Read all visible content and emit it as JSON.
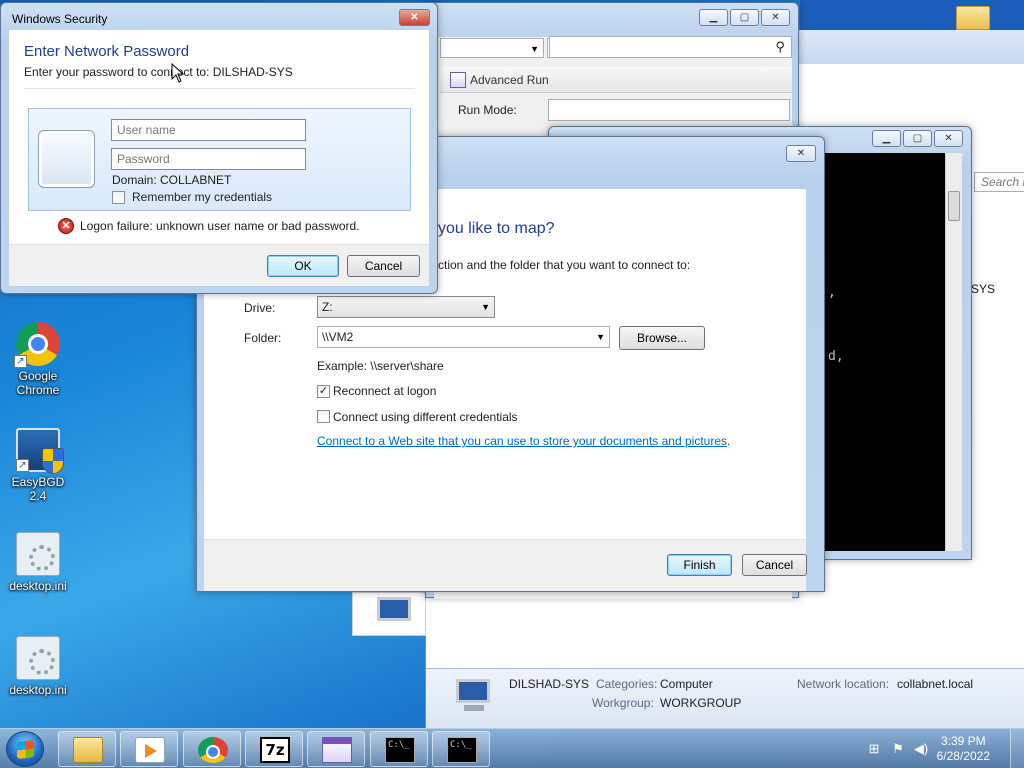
{
  "desktop": {
    "icons": [
      {
        "label": "Google Chrome"
      },
      {
        "label": "EasyBGD 2.4"
      },
      {
        "label": "desktop.ini"
      },
      {
        "label": "desktop.ini"
      }
    ]
  },
  "explorer": {
    "search_placeholder": "Search N",
    "partial_label": "SYS",
    "details": {
      "computer_name": "DILSHAD-SYS",
      "categories_label": "Categories:",
      "categories_value": "Computer",
      "workgroup_label": "Workgroup:",
      "workgroup_value": "WORKGROUP",
      "network_label": "Network location:",
      "network_value": "collabnet.local"
    }
  },
  "advanced_run": {
    "title": "Advanced Run",
    "run_mode_label": "Run Mode:"
  },
  "console": {
    "line1": ",",
    "line2": "d,"
  },
  "map_drive": {
    "heading": "you like to map?",
    "instruction": "ction and the folder that you want to connect to:",
    "drive_label": "Drive:",
    "drive_value": "Z:",
    "folder_label": "Folder:",
    "folder_value": "\\\\VM2",
    "browse_label": "Browse...",
    "example_text": "Example: \\\\server\\share",
    "reconnect_label": "Reconnect at logon",
    "reconnect_checked": true,
    "diff_creds_label": "Connect using different credentials",
    "diff_creds_checked": false,
    "web_link": "Connect to a Web site that you can use to store your documents and pictures",
    "link_suffix": ".",
    "finish_label": "Finish",
    "cancel_label": "Cancel"
  },
  "security": {
    "title": "Windows Security",
    "heading": "Enter Network Password",
    "subtext": "Enter your password to connect to: DILSHAD-SYS",
    "username_placeholder": "User name",
    "password_placeholder": "Password",
    "domain": "Domain: COLLABNET",
    "remember_label": "Remember my credentials",
    "remember_checked": false,
    "error_text": "Logon failure: unknown user name or bad password.",
    "ok_label": "OK",
    "cancel_label": "Cancel"
  },
  "taskbar": {
    "cmd_glyph": "C:\\_",
    "sevenzip_glyph": "7z",
    "time": "3:39 PM",
    "date": "6/28/2022"
  },
  "colors": {
    "heading_blue": "#1c3f95",
    "link_blue": "#0066cc",
    "error_red": "#c0150b"
  }
}
